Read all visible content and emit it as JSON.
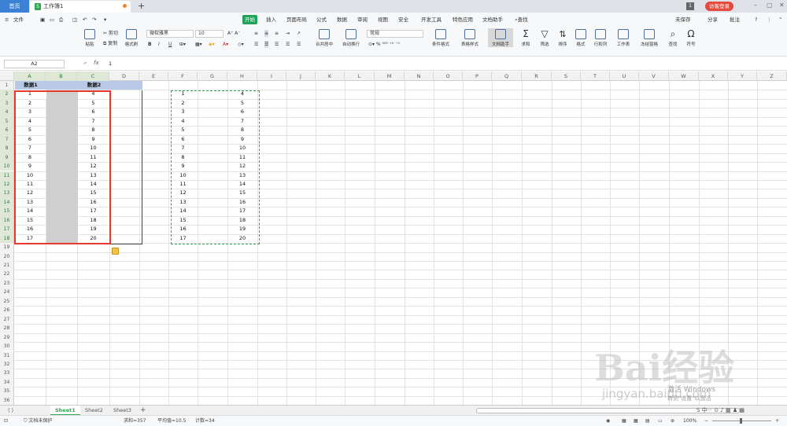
{
  "titlebar": {
    "home_tab": "首页",
    "doc_tab": "工作簿1",
    "doc_icon": "S",
    "add": "+",
    "badge": "1",
    "login": "访客登录"
  },
  "menu": [
    "开始",
    "插入",
    "页面布局",
    "公式",
    "数据",
    "审阅",
    "视图",
    "安全",
    "开发工具",
    "特色应用",
    "文档助手"
  ],
  "menu_left": {
    "file": "文件"
  },
  "search": "查找",
  "right_menu": {
    "unsaved": "未保存",
    "share": "分享",
    "comment": "批注"
  },
  "ribbon": {
    "paste": "粘贴",
    "cut": "剪切",
    "copy": "复制",
    "format_painter": "格式刷",
    "font_name": "微软雅黑",
    "font_size": "10",
    "merge": "合并居中",
    "wrap": "自动换行",
    "number_format": "常规",
    "cond_format": "条件格式",
    "table_style": "表格样式",
    "doc_helper": "文档助手",
    "sum": "求和",
    "filter": "筛选",
    "sort": "排序",
    "format": "格式",
    "rowcol": "行和列",
    "sheet": "工作表",
    "freeze": "冻结窗格",
    "find": "查找",
    "symbol": "符号",
    "bold": "B",
    "italic": "I",
    "underline": "U"
  },
  "formula_bar": {
    "name_box": "A2",
    "fx": "fx",
    "value": "1"
  },
  "columns": [
    "A",
    "B",
    "C",
    "D",
    "E",
    "F",
    "G",
    "H",
    "I",
    "J",
    "K",
    "L",
    "M",
    "N",
    "O",
    "P",
    "Q",
    "R",
    "S",
    "T",
    "U",
    "V",
    "W",
    "X",
    "Y",
    "Z"
  ],
  "rows": [
    "1",
    "2",
    "3",
    "4",
    "5",
    "6",
    "7",
    "8",
    "9",
    "10",
    "11",
    "12",
    "13",
    "14",
    "15",
    "16",
    "17",
    "18",
    "19",
    "20",
    "21",
    "22",
    "23",
    "24",
    "25",
    "26",
    "27",
    "28",
    "29",
    "30",
    "31",
    "32",
    "33",
    "34",
    "35",
    "36"
  ],
  "table": {
    "header1": "数据1",
    "header2": "数据2",
    "col_a": [
      "1",
      "2",
      "3",
      "4",
      "5",
      "6",
      "7",
      "8",
      "9",
      "10",
      "11",
      "12",
      "13",
      "14",
      "15",
      "16",
      "17"
    ],
    "col_c": [
      "4",
      "5",
      "6",
      "7",
      "8",
      "9",
      "10",
      "11",
      "12",
      "13",
      "14",
      "15",
      "16",
      "17",
      "18",
      "19",
      "20"
    ]
  },
  "copied": {
    "col_f": [
      "1",
      "2",
      "3",
      "4",
      "5",
      "6",
      "7",
      "8",
      "9",
      "10",
      "11",
      "12",
      "13",
      "14",
      "15",
      "16",
      "17"
    ],
    "col_h": [
      "4",
      "5",
      "6",
      "7",
      "8",
      "9",
      "10",
      "11",
      "12",
      "13",
      "14",
      "15",
      "16",
      "17",
      "18",
      "19",
      "20"
    ]
  },
  "sheets": [
    "Sheet1",
    "Sheet2",
    "Sheet3"
  ],
  "status": {
    "protect": "文档未保护",
    "sum": "求和=357",
    "avg": "平均值=10.5",
    "count": "计数=34",
    "zoom": "100%"
  },
  "watermark": {
    "brand": "Bai经验",
    "url": "jingyan.baidu.com",
    "activate_1": "激活 Windows",
    "activate_2": "转到\"设置\"以激活"
  },
  "colors": {
    "accent": "#2fa84f",
    "selection_red": "#e63a2e",
    "header_fill": "#b7c9e5",
    "shade": "#cfcfcf"
  }
}
